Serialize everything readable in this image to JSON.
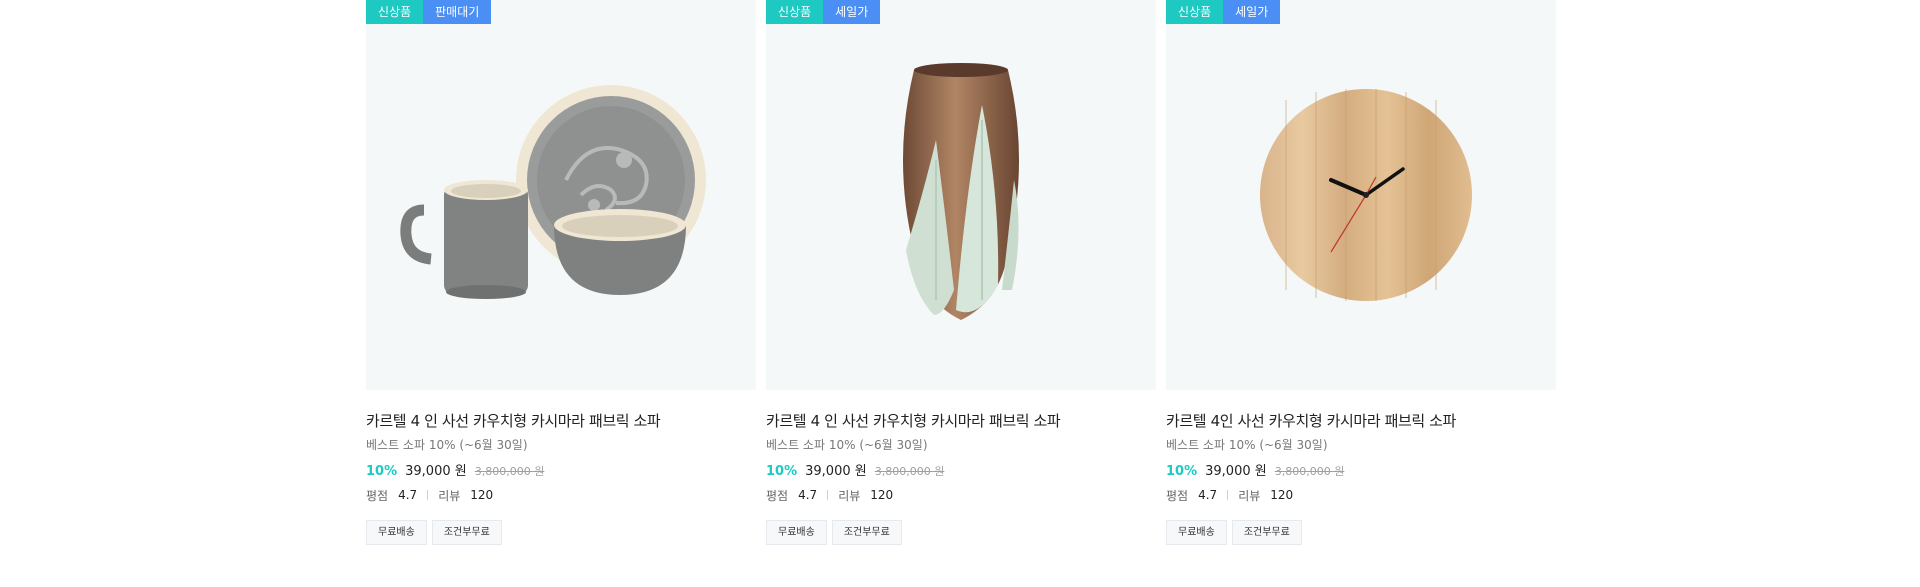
{
  "products": [
    {
      "badges": [
        {
          "label": "신상품",
          "color": "#1ec9c2"
        },
        {
          "label": "판매대기",
          "color": "#4b8ef4"
        }
      ],
      "image_icon": "tableware-set-icon",
      "title": "카르텔 4 인 사선 카우치형 카시마라 패브릭 소파",
      "subtitle": "베스트 소파 10% (~6월 30일)",
      "discount": "10%",
      "price": "39,000 원",
      "original_price": "3,800,000 원",
      "rating_label": "평점",
      "rating_value": "4.7",
      "review_label": "리뷰",
      "review_value": "120",
      "tags": [
        "무료배송",
        "조건부무료"
      ]
    },
    {
      "badges": [
        {
          "label": "신상품",
          "color": "#1ec9c2"
        },
        {
          "label": "세일가",
          "color": "#4b8ef4"
        }
      ],
      "image_icon": "vase-icon",
      "title": "카르텔 4 인 사선 카우치형 카시마라 패브릭 소파",
      "subtitle": "베스트 소파 10% (~6월 30일)",
      "discount": "10%",
      "price": "39,000 원",
      "original_price": "3,800,000 원",
      "rating_label": "평점",
      "rating_value": "4.7",
      "review_label": "리뷰",
      "review_value": "120",
      "tags": [
        "무료배송",
        "조건부무료"
      ]
    },
    {
      "badges": [
        {
          "label": "신상품",
          "color": "#1ec9c2"
        },
        {
          "label": "세일가",
          "color": "#4b8ef4"
        }
      ],
      "image_icon": "wall-clock-icon",
      "title": "카르텔 4인 사선 카우치형 카시마라 패브릭 소파",
      "subtitle": "베스트 소파 10% (~6월 30일)",
      "discount": "10%",
      "price": "39,000 원",
      "original_price": "3,800,000 원",
      "rating_label": "평점",
      "rating_value": "4.7",
      "review_label": "리뷰",
      "review_value": "120",
      "tags": [
        "무료배송",
        "조건부무료"
      ]
    }
  ]
}
